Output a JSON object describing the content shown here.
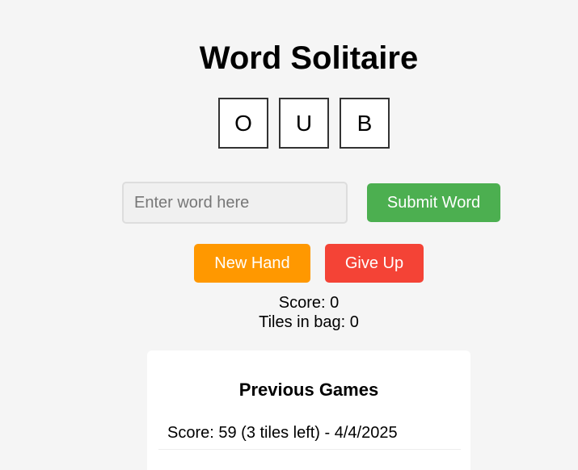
{
  "app": {
    "title": "Word Solitaire"
  },
  "hand": {
    "tiles": [
      "O",
      "U",
      "B"
    ]
  },
  "word_entry": {
    "value": "",
    "placeholder": "Enter word here",
    "submit_label": "Submit Word"
  },
  "actions": {
    "new_hand_label": "New Hand",
    "give_up_label": "Give Up",
    "colors": {
      "submit": "#4caf50",
      "new_hand": "#ff9800",
      "give_up": "#f44336"
    }
  },
  "stats": {
    "score_text": "Score: 0",
    "tiles_in_bag_text": "Tiles in bag: 0"
  },
  "history": {
    "title": "Previous Games",
    "games": [
      "Score: 59 (3 tiles left) - 4/4/2025"
    ]
  }
}
